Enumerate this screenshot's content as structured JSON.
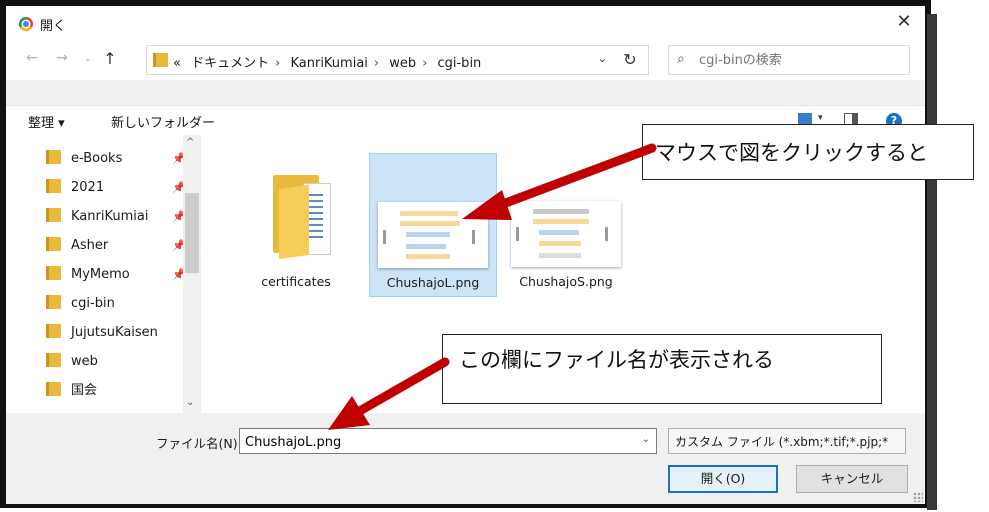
{
  "window": {
    "title": "開く",
    "close_icon": "close-icon"
  },
  "nav": {
    "back_icon": "arrow-left-icon",
    "forward_icon": "arrow-right-icon",
    "recent_icon": "chevron-down-icon",
    "up_icon": "arrow-up-icon",
    "breadcrumb": [
      "«",
      "ドキュメント",
      "KanriKumiai",
      "web",
      "cgi-bin"
    ],
    "search_placeholder": "cgi-binの検索"
  },
  "toolbar": {
    "organize_label": "整理 ▾",
    "new_folder_label": "新しいフォルダー"
  },
  "sidebar": {
    "items": [
      {
        "label": "e-Books",
        "pinned": true
      },
      {
        "label": "2021",
        "pinned": true
      },
      {
        "label": "KanriKumiai",
        "pinned": true
      },
      {
        "label": "Asher",
        "pinned": true
      },
      {
        "label": "MyMemo",
        "pinned": true
      },
      {
        "label": "cgi-bin",
        "pinned": false
      },
      {
        "label": "JujutsuKaisen",
        "pinned": false
      },
      {
        "label": "web",
        "pinned": false
      },
      {
        "label": "国会",
        "pinned": false
      }
    ]
  },
  "files": [
    {
      "name": "certificates",
      "kind": "folder",
      "selected": false
    },
    {
      "name": "ChushajoL.png",
      "kind": "image",
      "selected": true
    },
    {
      "name": "ChushajoS.png",
      "kind": "image",
      "selected": false
    }
  ],
  "footer": {
    "filename_label": "ファイル名(N):",
    "filename_value": "ChushajoL.png",
    "filetype_label": "カスタム ファイル (*.xbm;*.tif;*.pjp;*",
    "open_label": "開く(O)",
    "cancel_label": "キャンセル"
  },
  "annotations": {
    "callout_1": "マウスで図をクリックすると",
    "callout_2": "この欄にファイル名が表示される"
  },
  "colors": {
    "accent": "#1a6fc9",
    "selection": "#cce4f7",
    "folder": "#e8b93a",
    "arrow": "#c00000"
  }
}
